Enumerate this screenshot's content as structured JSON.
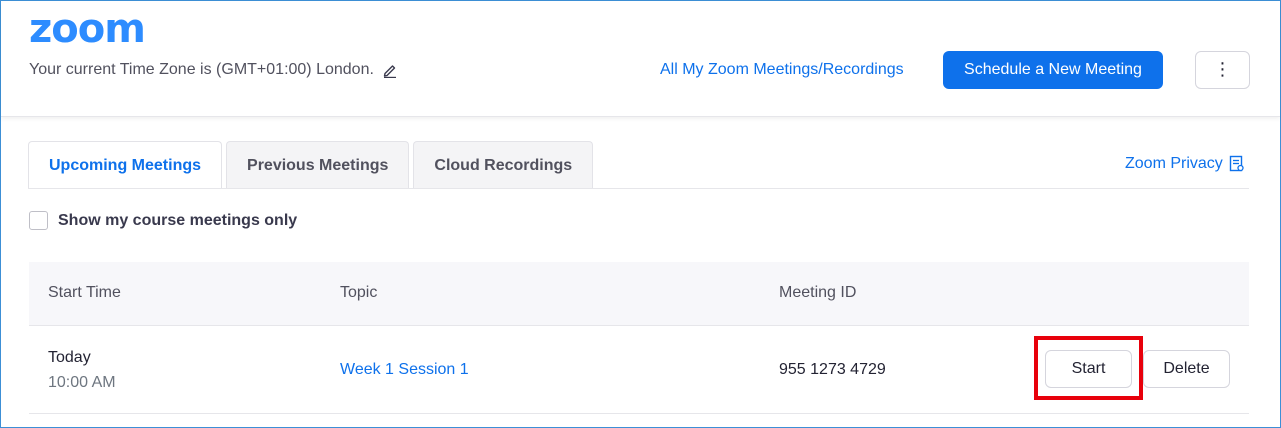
{
  "header": {
    "logo_text": "zoom",
    "timezone_text": "Your current Time Zone is (GMT+01:00) London.",
    "all_meetings_link": "All My Zoom Meetings/Recordings",
    "schedule_button": "Schedule a New Meeting",
    "more_button": "⋮"
  },
  "tabs": [
    {
      "label": "Upcoming Meetings",
      "active": true
    },
    {
      "label": "Previous Meetings",
      "active": false
    },
    {
      "label": "Cloud Recordings",
      "active": false
    }
  ],
  "privacy_link": "Zoom Privacy",
  "filter": {
    "label": "Show my course meetings only",
    "checked": false
  },
  "table": {
    "headers": {
      "start_time": "Start Time",
      "topic": "Topic",
      "meeting_id": "Meeting ID"
    },
    "rows": [
      {
        "day": "Today",
        "time": "10:00 AM",
        "topic": "Week 1 Session 1",
        "meeting_id": "955 1273 4729",
        "start_label": "Start",
        "delete_label": "Delete"
      }
    ]
  },
  "colors": {
    "brand_blue": "#2d8cff",
    "link_blue": "#0e71eb",
    "highlight_red": "#e8000b"
  },
  "icons": {
    "edit_timezone": "pencil-icon",
    "privacy": "document-icon",
    "more": "kebab-menu-icon"
  }
}
